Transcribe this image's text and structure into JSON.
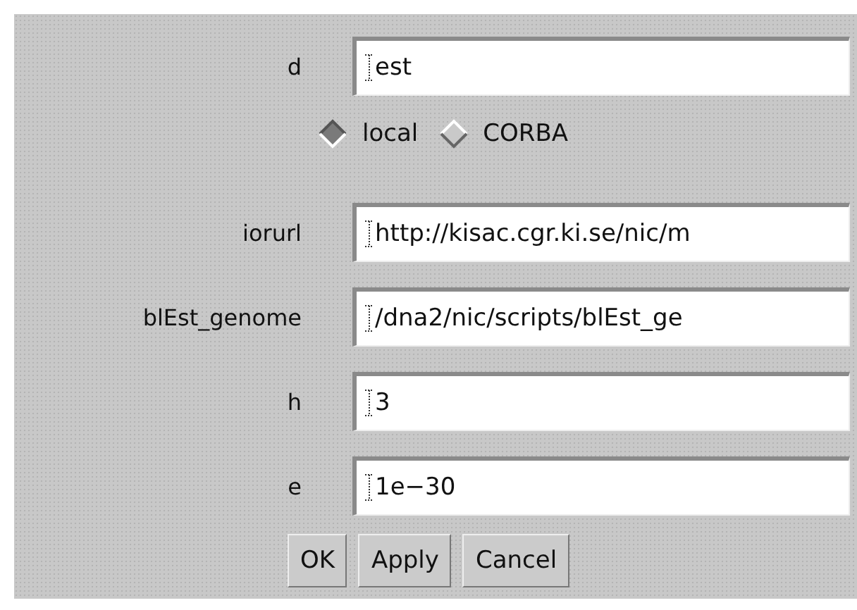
{
  "fields_top": [
    {
      "label": "d",
      "value": "est"
    }
  ],
  "mode": [
    {
      "label": "local",
      "selected": true
    },
    {
      "label": "CORBA",
      "selected": false
    }
  ],
  "fields": [
    {
      "label": "iorurl",
      "value": "http://kisac.cgr.ki.se/nic/m"
    },
    {
      "label": "blEst_genome",
      "value": "/dna2/nic/scripts/blEst_ge"
    },
    {
      "label": "h",
      "value": "3"
    },
    {
      "label": "e",
      "value": "1e−30"
    }
  ],
  "buttons": [
    "OK",
    "Apply",
    "Cancel"
  ]
}
